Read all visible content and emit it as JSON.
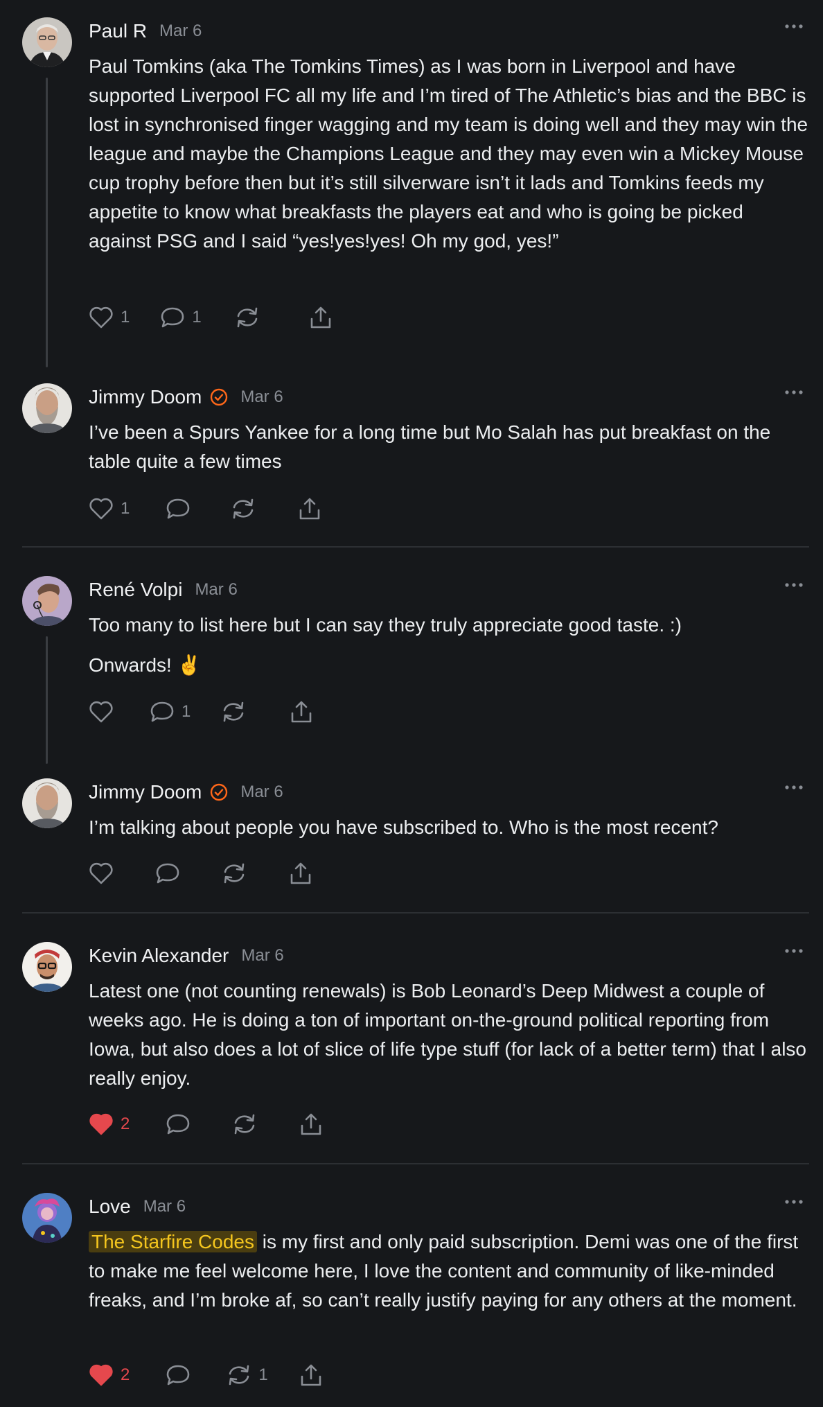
{
  "colors": {
    "background": "#16181b",
    "text": "#eceef0",
    "muted": "#8a8e95",
    "like_red": "#e5484d",
    "verified_orange": "#ff6719",
    "highlight_bg": "#4a3d10",
    "highlight_text": "#f5c61e"
  },
  "icons": {
    "like": "heart-icon",
    "reply": "speech-bubble-icon",
    "restack": "restack-arrows-icon",
    "share": "share-upload-icon",
    "more": "ellipsis-icon",
    "verified": "verified-check-icon"
  },
  "comments": [
    {
      "author": "Paul R",
      "date": "Mar 6",
      "verified": false,
      "paragraphs": [
        "Paul Tomkins (aka The Tomkins Times) as I was born in Liverpool and have supported Liverpool FC all my life and I’m tired of The Athletic’s bias and the BBC is lost in synchronised finger wagging and my team is doing well and they may win the league and maybe the Champions League and they may even win a Mickey Mouse cup trophy before then but it’s still silverware isn’t it lads and Tomkins feeds my appetite to know what breakfasts the players eat and who is going be picked against PSG and I said “yes!yes!yes! Oh my god, yes!”"
      ],
      "likes": "1",
      "liked": false,
      "replies": "1",
      "restacks": ""
    },
    {
      "author": "Jimmy Doom",
      "date": "Mar 6",
      "verified": true,
      "paragraphs": [
        "I’ve been a Spurs Yankee for a long time but Mo Salah has put breakfast on the table quite a few times"
      ],
      "likes": "1",
      "liked": false,
      "replies": "",
      "restacks": ""
    },
    {
      "author": "René Volpi",
      "date": "Mar 6",
      "verified": false,
      "paragraphs": [
        "Too many to list here but I can say they truly appreciate good taste. :)",
        "Onwards! ✌️"
      ],
      "likes": "",
      "liked": false,
      "replies": "1",
      "restacks": ""
    },
    {
      "author": "Jimmy Doom",
      "date": "Mar 6",
      "verified": true,
      "paragraphs": [
        "I’m talking about people you have subscribed to. Who is the most recent?"
      ],
      "likes": "",
      "liked": false,
      "replies": "",
      "restacks": ""
    },
    {
      "author": "Kevin Alexander",
      "date": "Mar 6",
      "verified": false,
      "paragraphs": [
        "Latest one (not counting renewals) is Bob Leonard’s Deep Midwest a couple of weeks ago. He is doing a ton of important on-the-ground political reporting from Iowa, but also does a lot of slice of life type stuff (for lack of a better term) that I also really enjoy."
      ],
      "likes": "2",
      "liked": true,
      "replies": "",
      "restacks": ""
    },
    {
      "author": "Love",
      "date": "Mar 6",
      "verified": false,
      "highlight": "The Starfire Codes",
      "paragraphs": [
        " is my first and only paid subscription. Demi was one of the first to make me feel welcome here, I love the content and community of like-minded freaks, and I’m broke af, so can’t really justify paying for any others at the moment."
      ],
      "likes": "2",
      "liked": true,
      "replies": "",
      "restacks": "1"
    }
  ]
}
